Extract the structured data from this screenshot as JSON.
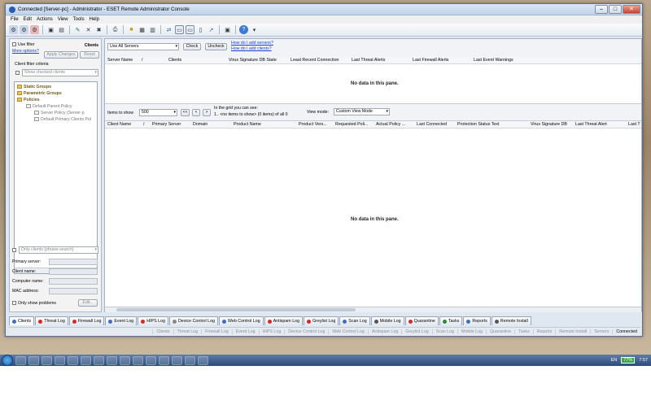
{
  "window": {
    "title": "Connected [Server-pc] - Administrator - ESET Remote Administrator Console"
  },
  "menu": [
    "File",
    "Edit",
    "Actions",
    "View",
    "Tools",
    "Help"
  ],
  "left": {
    "use_filter": "Use filter",
    "clients_header": "Clients",
    "more_options": "More options?",
    "apply_changes": "Apply Changes",
    "reset": "Reset",
    "criteria": "Client filter criteria",
    "show_checked": "Show checked clients",
    "tree": [
      "Static Groups",
      "Parametric Groups",
      "Policies",
      "Default Parent Policy",
      "Server Policy (Server-p",
      "Default Primary Clients Pol"
    ],
    "only_clients": "Only clients (phrase search)",
    "fields": [
      "Primary server:",
      "Client name:",
      "Computer name:",
      "MAC address:"
    ],
    "only_problems": "Only show problems",
    "edit": "Edit..."
  },
  "servers": {
    "select": "Use All Servers",
    "check": "Check",
    "uncheck": "Uncheck",
    "link1": "How do I add servers?",
    "link2": "How do I add clients?",
    "columns": [
      "Server Name",
      "/",
      "Clients",
      "Virus Signature DB State",
      "Least Recent Connection",
      "Last Threat Alerts",
      "Last Firewall Alerts",
      "Last Event Warnings"
    ],
    "nodata": "No data in this pane."
  },
  "clients": {
    "items_label": "Items to show",
    "items_value": "500",
    "nav": [
      "<<",
      "<",
      ">"
    ],
    "grid_see": "In the grid you can see:",
    "grid_count": "1.. <no items to show> (0 items) of all 0",
    "view_mode_label": "View mode:",
    "view_mode_value": "Custom View Mode",
    "columns": [
      "Client Name",
      "/",
      "Primary Server",
      "Domain",
      "Product Name",
      "Product Vers...",
      "Requested Poli...",
      "Actual Policy ...",
      "Last Connected",
      "Protection Status Text",
      "Virus Signature DB",
      "Last Threat Alert",
      "Last T"
    ],
    "nodata": "No data in this pane."
  },
  "tabs": [
    "Clients",
    "Threat Log",
    "Firewall Log",
    "Event Log",
    "HIPS Log",
    "Device Control Log",
    "Web Control Log",
    "Antispam Log",
    "Greylist Log",
    "Scan Log",
    "Mobile Log",
    "Quarantine",
    "Tasks",
    "Reports",
    "Remote Install"
  ],
  "status_tabs": [
    "Clients",
    "Threat Log",
    "Firewall Log",
    "Event Log",
    "HIPS Log",
    "Device Control Log",
    "Web Control Log",
    "Antispam Log",
    "Greylist Log",
    "Scan Log",
    "Mobile Log",
    "Quarantine",
    "Tasks",
    "Reports",
    "Remote Install",
    "Servers",
    "Connected"
  ],
  "tray": {
    "lang": "EN",
    "battery": "77%",
    "time": "7:57"
  }
}
